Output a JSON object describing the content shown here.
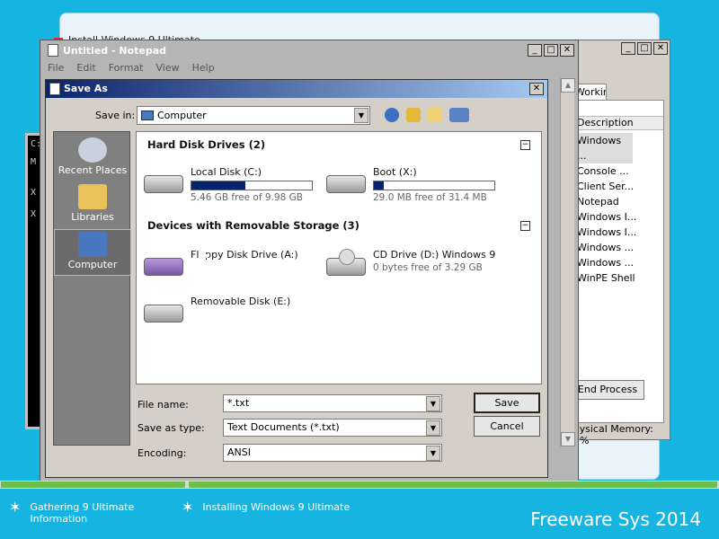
{
  "installer": {
    "title": "Install Windows 9 Ultimate"
  },
  "task_manager": {
    "tab_label": "Working",
    "column_header": "Description",
    "rows": [
      "Windows ...",
      "Console ...",
      "Client Ser...",
      "Notepad",
      "Windows I...",
      "Windows I...",
      "Windows ...",
      "Windows ...",
      "WinPE Shell"
    ],
    "end_process_label": "End Process",
    "memory_text": "Physical Memory: 35%"
  },
  "console": {
    "lines": [
      "C:",
      "M",
      "X",
      "X"
    ]
  },
  "notepad": {
    "title": "Untitled - Notepad",
    "menu": [
      "File",
      "Edit",
      "Format",
      "View",
      "Help"
    ]
  },
  "save_dialog": {
    "title": "Save As",
    "save_in_label": "Save in:",
    "save_in_value": "Computer",
    "places": [
      {
        "label": "Recent Places",
        "icon": "recent-places-icon"
      },
      {
        "label": "Libraries",
        "icon": "libraries-icon"
      },
      {
        "label": "Computer",
        "icon": "computer-icon"
      }
    ],
    "groups": [
      {
        "title": "Hard Disk Drives (2)"
      },
      {
        "title": "Devices with Removable Storage (3)"
      }
    ],
    "drives": [
      {
        "name": "Local Disk (C:)",
        "free": "5.46 GB free of 9.98 GB",
        "used_fraction": 0.45,
        "has_bar": true
      },
      {
        "name": "Boot (X:)",
        "free": "29.0 MB free of 31.4 MB",
        "used_fraction": 0.08,
        "has_bar": true
      },
      {
        "name": "Floppy Disk Drive (A:)",
        "free": "",
        "has_bar": false
      },
      {
        "name": "CD Drive (D:) Windows 9",
        "free": "0 bytes free of 3.29 GB",
        "has_bar": false
      },
      {
        "name": "Removable Disk (E:)",
        "free": "",
        "has_bar": false
      }
    ],
    "file_name_label": "File name:",
    "file_name_value": "*.txt",
    "save_type_label": "Save as type:",
    "save_type_value": "Text Documents (*.txt)",
    "encoding_label": "Encoding:",
    "encoding_value": "ANSI",
    "save_button": "Save",
    "cancel_button": "Cancel"
  },
  "footer": {
    "steps": [
      "Gathering 9 Ultimate Information",
      "Installing Windows 9 Ultimate"
    ],
    "brand": "Freeware Sys 2014",
    "progress_colors": {
      "done": "#6dbf4a",
      "track": "#d9d9d9"
    }
  },
  "colors": {
    "desktop": "#16b4e0",
    "title_bar": "#0a246a",
    "drive_fill": "#0a246a"
  }
}
